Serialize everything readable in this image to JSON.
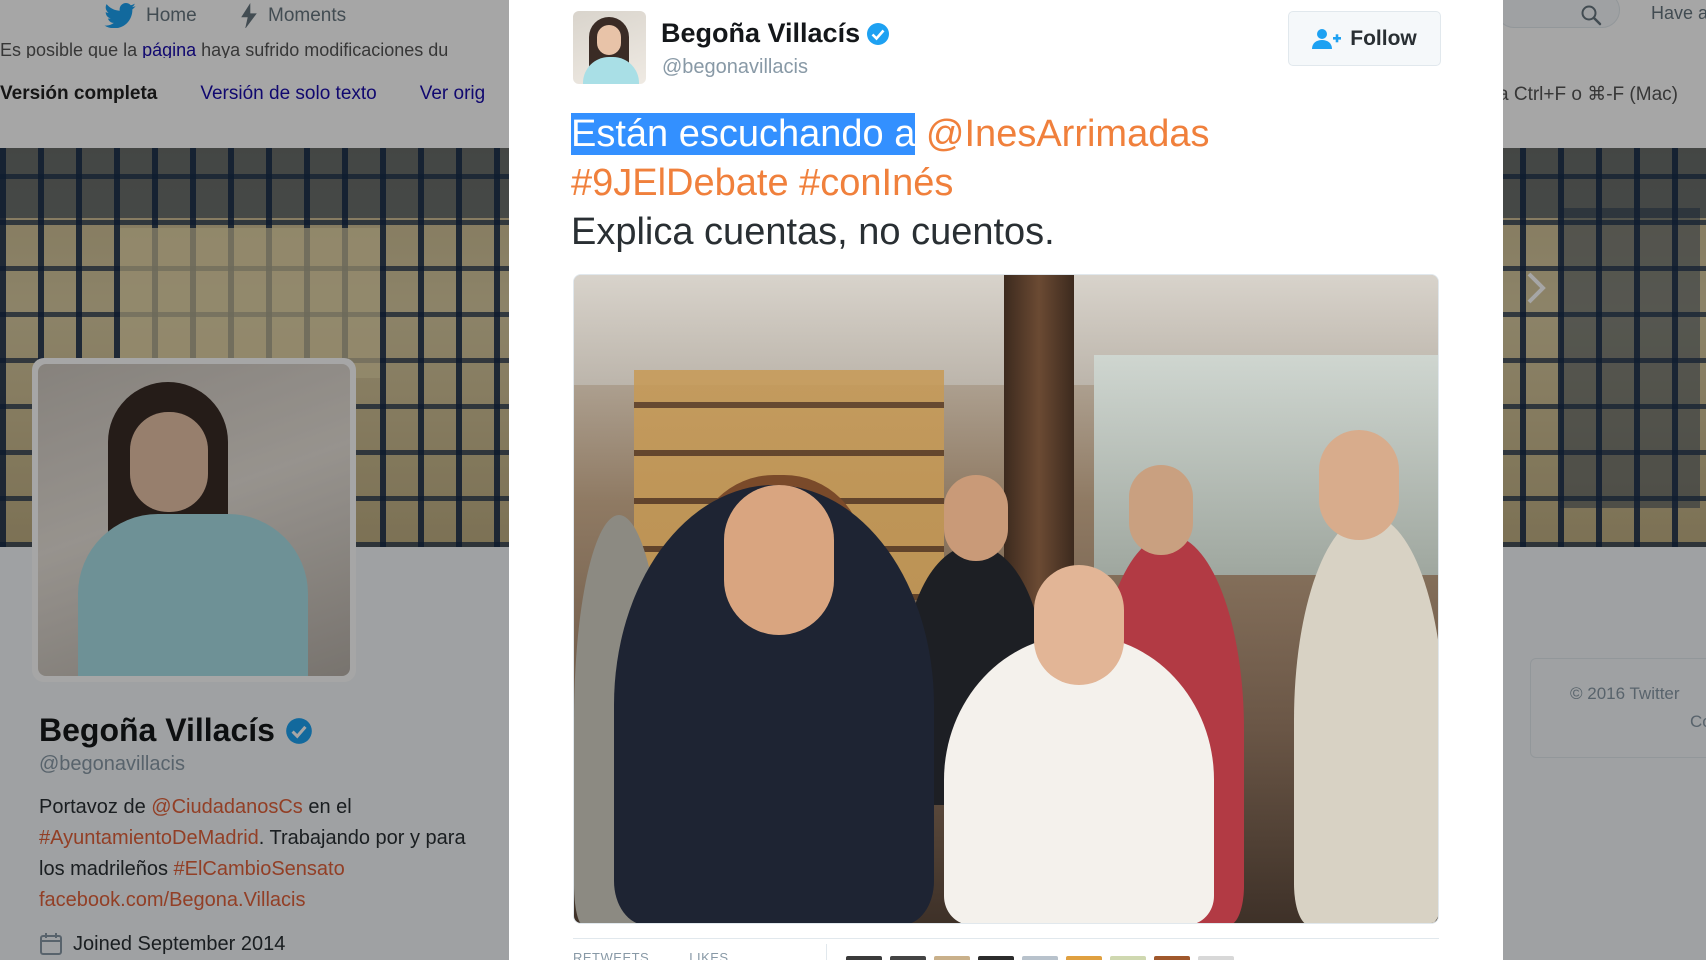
{
  "nav": {
    "home_label": "Home",
    "moments_label": "Moments",
    "have_label": "Have a"
  },
  "notice": {
    "text_before": "Es posible que la ",
    "link": "página",
    "text_after": " haya sufrido modificaciones du",
    "version_full": "Versión completa",
    "version_text": "Versión de solo texto",
    "view_original": "Ver orig",
    "search_hint": "a Ctrl+F o ⌘-F (Mac)"
  },
  "profile": {
    "name": "Begoña Villacís",
    "handle": "@begonavillacis",
    "bio": {
      "t1": "Portavoz de ",
      "mention": "@CiudadanosCs",
      "t2": " en el",
      "hashtag1": "#AyuntamientoDeMadrid",
      "t3": ". Trabajando por y para los madrileños ",
      "hashtag2": "#ElCambioSensato",
      "link": "facebook.com/Begona.Villacis"
    },
    "joined": "Joined September 2014"
  },
  "footer": {
    "copyright": "© 2016 Twitter",
    "trailing": "Co"
  },
  "tweet": {
    "author_name": "Begoña Villacís",
    "author_handle": "@begonavillacis",
    "follow_label": "Follow",
    "text_selected": "Están escuchando a",
    "mention": "@InesArrimadas",
    "hashtag1": "#9JElDebate",
    "hashtag2": "#conInés",
    "line3": "Explica cuentas, no cuentos.",
    "retweets_label": "RETWEETS",
    "likes_label": "LIKES"
  },
  "colors": {
    "twitter_blue": "#1da1f2",
    "entity_orange": "#f0803c",
    "profile_link": "#e0613b",
    "selection": "#3390ff",
    "verified": "#1da1f2"
  }
}
